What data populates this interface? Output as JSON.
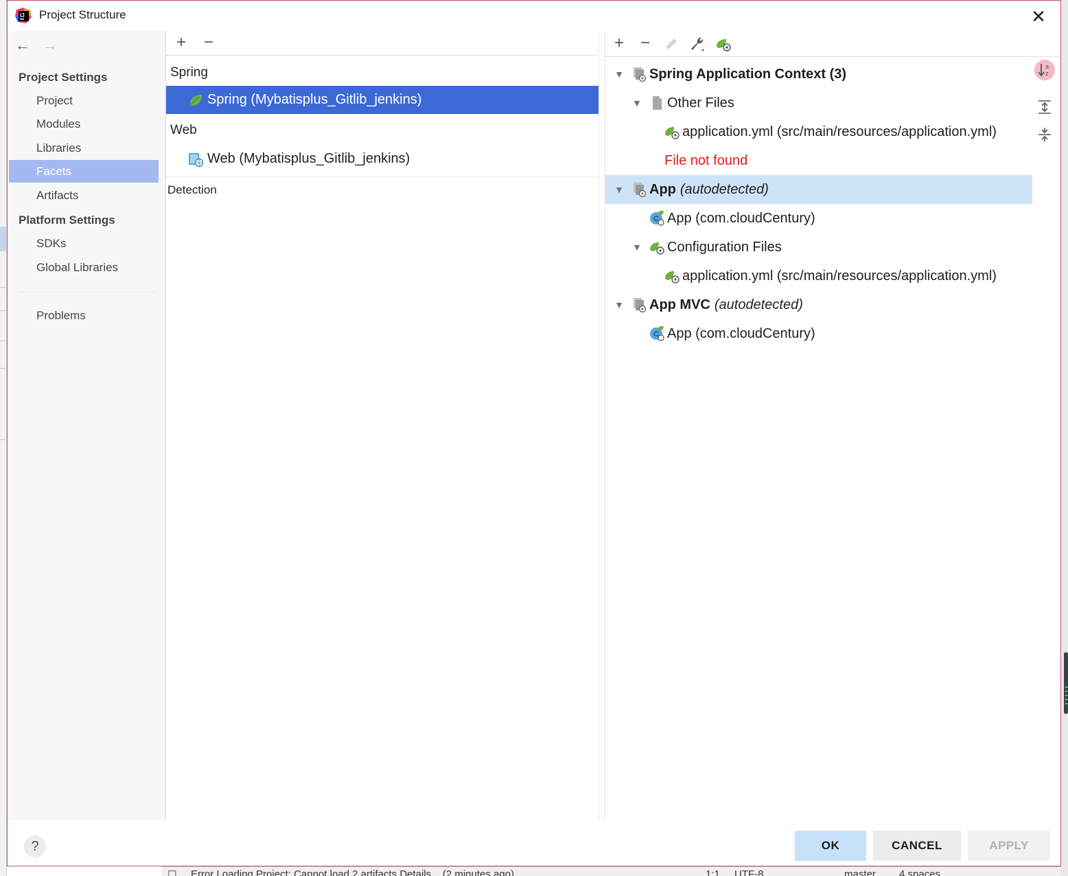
{
  "dialog": {
    "title": "Project Structure",
    "close_glyph": "✕"
  },
  "nav": {
    "back_glyph": "←",
    "forward_glyph": "→",
    "project_settings_heading": "Project Settings",
    "platform_settings_heading": "Platform Settings",
    "items": [
      {
        "label": "Project",
        "selected": false
      },
      {
        "label": "Modules",
        "selected": false
      },
      {
        "label": "Libraries",
        "selected": false
      },
      {
        "label": "Facets",
        "selected": true
      },
      {
        "label": "Artifacts",
        "selected": false
      },
      {
        "label": "SDKs",
        "selected": false
      },
      {
        "label": "Global Libraries",
        "selected": false
      },
      {
        "label": "Problems",
        "selected": false
      }
    ]
  },
  "facets": {
    "add_glyph": "+",
    "remove_glyph": "−",
    "groups": [
      {
        "label": "Spring",
        "entries": [
          {
            "label": "Spring (Mybatisplus_Gitlib_jenkins)",
            "icon": "spring-leaf-icon",
            "selected": true
          }
        ]
      },
      {
        "label": "Web",
        "entries": [
          {
            "label": "Web (Mybatisplus_Gitlib_jenkins)",
            "icon": "web-facet-icon",
            "selected": false
          }
        ]
      }
    ],
    "detection_label": "Detection"
  },
  "context": {
    "toolbar": {
      "add_glyph": "+",
      "remove_glyph": "−"
    },
    "tree": [
      {
        "name": "Spring Application Context (3)",
        "suffix": "",
        "level": 0,
        "expanded": true,
        "icon": "context-icon",
        "bold": true,
        "selected": false
      },
      {
        "name": "Other Files",
        "suffix": "",
        "level": 1,
        "expanded": true,
        "icon": "file-icon",
        "bold": false,
        "selected": false
      },
      {
        "name": "application.yml (src/main/resources/application.yml)",
        "suffix": "",
        "level": 2,
        "expanded": null,
        "icon": "spring-config-icon",
        "bold": false,
        "selected": false
      },
      {
        "name": "File not found",
        "suffix": "",
        "level": 2,
        "expanded": null,
        "icon": "",
        "bold": false,
        "selected": false,
        "error": true
      },
      {
        "name": "App",
        "suffix": "(autodetected)",
        "level": 0,
        "expanded": true,
        "icon": "context-icon",
        "bold": true,
        "selected": true
      },
      {
        "name": "App (com.cloudCentury)",
        "suffix": "",
        "level": 1,
        "expanded": null,
        "icon": "spring-class-icon",
        "bold": false,
        "selected": false
      },
      {
        "name": "Configuration Files",
        "suffix": "",
        "level": 1,
        "expanded": true,
        "icon": "spring-config-icon",
        "bold": false,
        "selected": false
      },
      {
        "name": "application.yml (src/main/resources/application.yml)",
        "suffix": "",
        "level": 2,
        "expanded": null,
        "icon": "spring-config-icon",
        "bold": false,
        "selected": false
      },
      {
        "name": "App MVC",
        "suffix": "(autodetected)",
        "level": 0,
        "expanded": true,
        "icon": "context-icon",
        "bold": true,
        "selected": false
      },
      {
        "name": "App (com.cloudCentury)",
        "suffix": "",
        "level": 1,
        "expanded": null,
        "icon": "spring-class-icon",
        "bold": false,
        "selected": false
      }
    ]
  },
  "footer": {
    "help_glyph": "?",
    "ok_label": "OK",
    "cancel_label": "CANCEL",
    "apply_label": "APPLY"
  },
  "statusbar": {
    "message": "Error Loading Project: Cannot load 2 artifacts Details... (2 minutes ago)",
    "position": "1:1",
    "encoding": "UTF-8",
    "branch": "master",
    "indent": "4 spaces"
  },
  "colors": {
    "selection_blue": "#3c69d6",
    "nav_selected": "#a4b9ef",
    "tree_selected": "#cfe3f8",
    "error_red": "#e01b1b",
    "spring_green": "#6db33f",
    "ok_button": "#c8e1fb"
  }
}
